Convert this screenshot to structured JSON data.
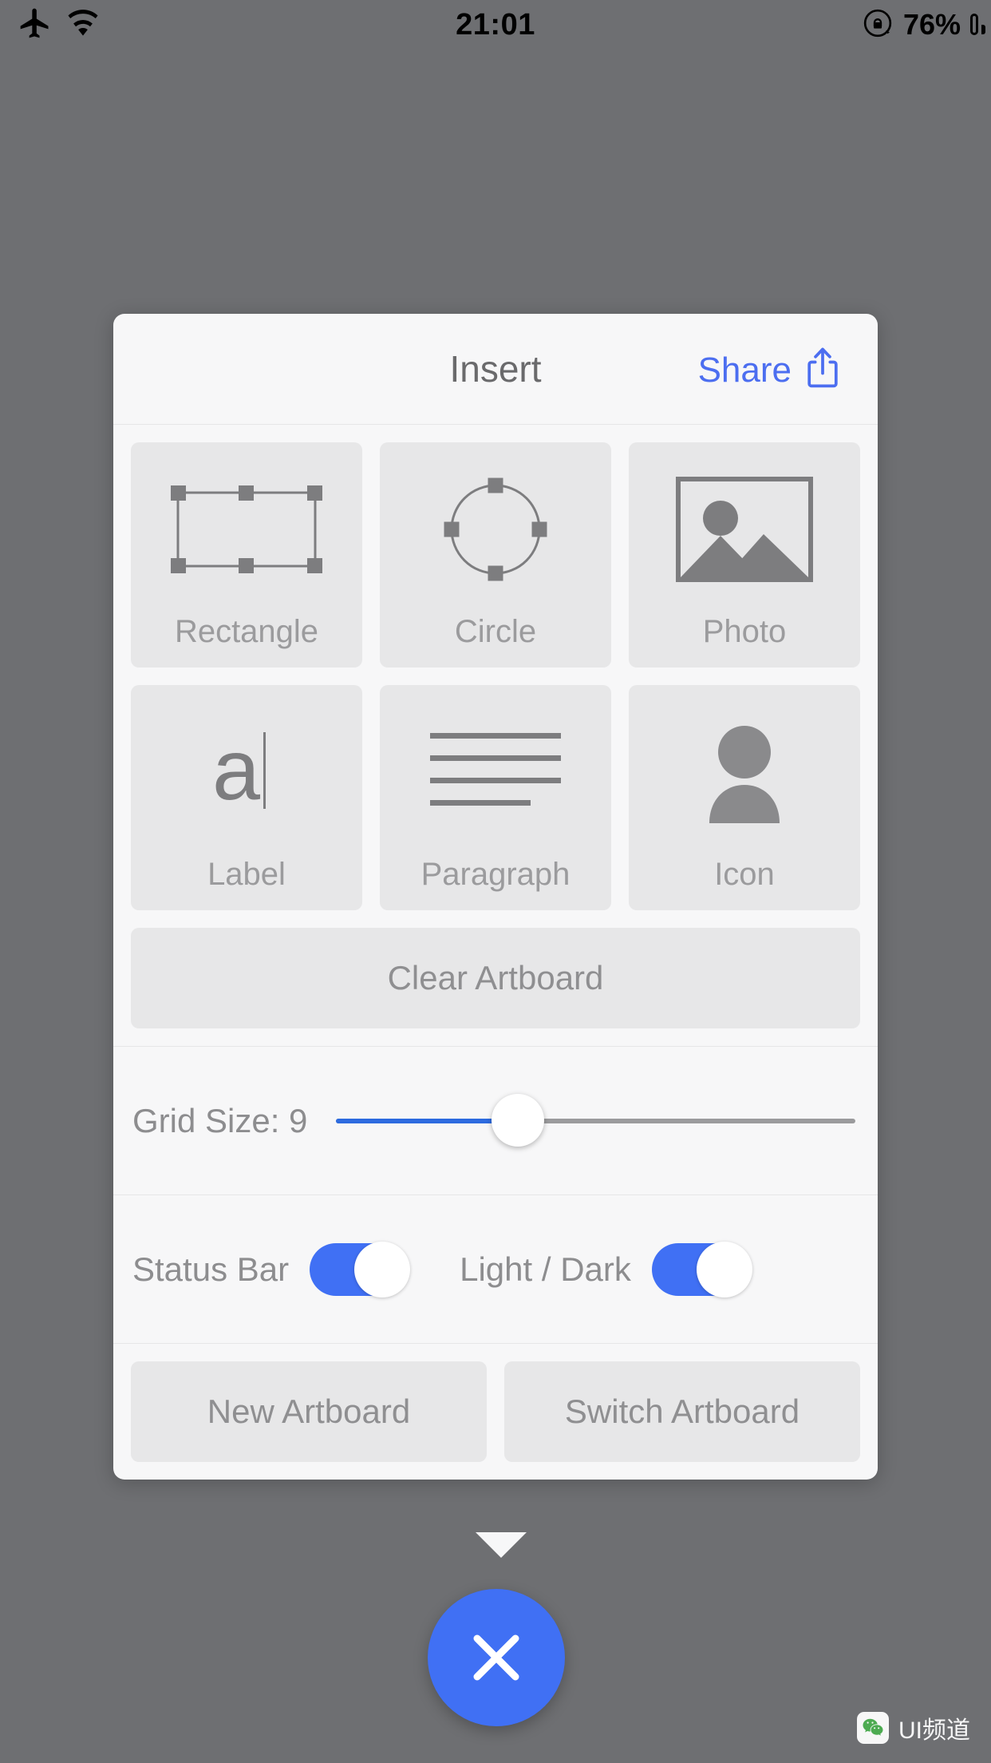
{
  "status_bar": {
    "airplane_icon": "airplane-mode-icon",
    "wifi_icon": "wifi-icon",
    "time": "21:01",
    "rotation_lock_icon": "rotation-lock-icon",
    "battery_percent": "76%",
    "battery_icon": "battery-icon"
  },
  "panel": {
    "title": "Insert",
    "share_label": "Share",
    "share_icon": "share-upload-icon",
    "tiles_row1": [
      {
        "label": "Rectangle",
        "icon": "rectangle-shape-icon"
      },
      {
        "label": "Circle",
        "icon": "circle-shape-icon"
      },
      {
        "label": "Photo",
        "icon": "photo-image-icon"
      }
    ],
    "tiles_row2": [
      {
        "label": "Label",
        "icon": "text-label-icon"
      },
      {
        "label": "Paragraph",
        "icon": "paragraph-lines-icon"
      },
      {
        "label": "Icon",
        "icon": "person-silhouette-icon"
      }
    ],
    "clear_artboard_label": "Clear Artboard",
    "grid": {
      "label": "Grid Size: 9",
      "value": 9,
      "fill_percent": 35
    },
    "toggles": [
      {
        "label": "Status Bar",
        "on": true
      },
      {
        "label": "Light / Dark",
        "on": true
      }
    ],
    "artboard_buttons": [
      {
        "label": "New Artboard"
      },
      {
        "label": "Switch Artboard"
      }
    ]
  },
  "fab": {
    "icon": "close-x-icon"
  },
  "watermark": {
    "icon": "wechat-icon",
    "text": "UI频道"
  },
  "colors": {
    "accent_blue": "#4070f4",
    "link_blue": "#4c6ef0",
    "slider_blue": "#2d6bdf",
    "panel_bg": "#f7f7f8",
    "tile_bg": "#e7e7e8",
    "overlay": "#6e6f72",
    "muted_text": "#8d8d8f"
  }
}
